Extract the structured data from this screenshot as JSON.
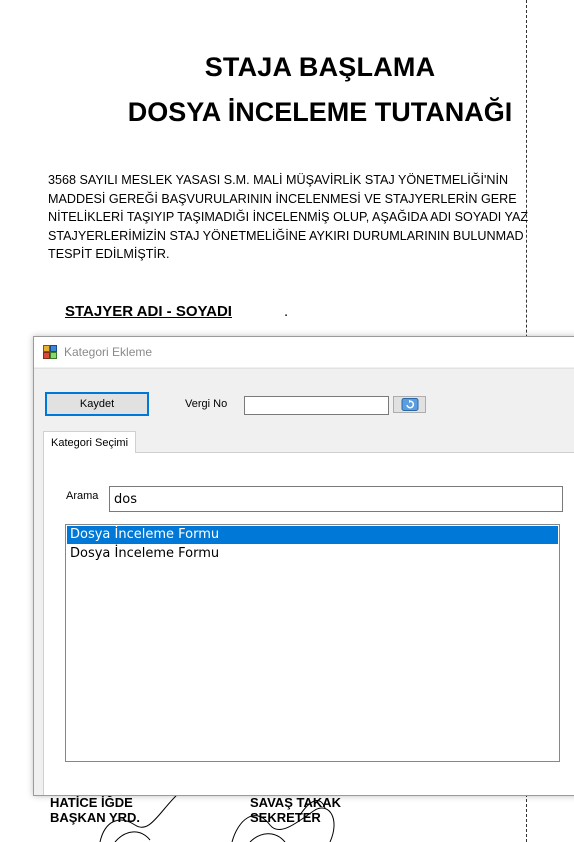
{
  "document": {
    "title_line1": "STAJA BAŞLAMA",
    "title_line2": "DOSYA İNCELEME TUTANAĞI",
    "paragraph_lines": [
      "3568 SAYILI MESLEK YASASI S.M. MALİ MÜŞAVİRLİK STAJ YÖNETMELİĞİ'NİN",
      "MADDESİ GEREĞİ BAŞVURULARININ İNCELENMESİ VE STAJYERLERİN GERE",
      "NİTELİKLERİ TAŞIYIP TAŞIMADIĞI İNCELENMİŞ OLUP, AŞAĞIDA ADI SOYADI YAZ",
      "STAJYERLERİMİZİN STAJ YÖNETMELİĞİNE AYKIRI DURUMLARININ BULUNMAD",
      "TESPİT EDİLMİŞTİR."
    ],
    "stajyer_heading": "STAJYER ADI - SOYADI",
    "stajyer_dot": ".",
    "signatures": [
      {
        "name": "HATİCE İĞDE",
        "role": "BAŞKAN YRD."
      },
      {
        "name": "SAVAŞ TAKAK",
        "role": "SEKRETER"
      }
    ]
  },
  "dialog": {
    "title": "Kategori Ekleme",
    "save_label": "Kaydet",
    "vergi_label": "Vergi No",
    "vergi_value": "",
    "tab_label": "Kategori Seçimi",
    "search_label": "Arama",
    "search_value": "dos",
    "results": [
      {
        "label": "Dosya İnceleme Formu",
        "selected": true
      },
      {
        "label": "Dosya İnceleme Formu",
        "selected": false
      }
    ],
    "accent_color": "#0078d7",
    "icons": [
      "app-icon",
      "refresh-icon"
    ]
  }
}
